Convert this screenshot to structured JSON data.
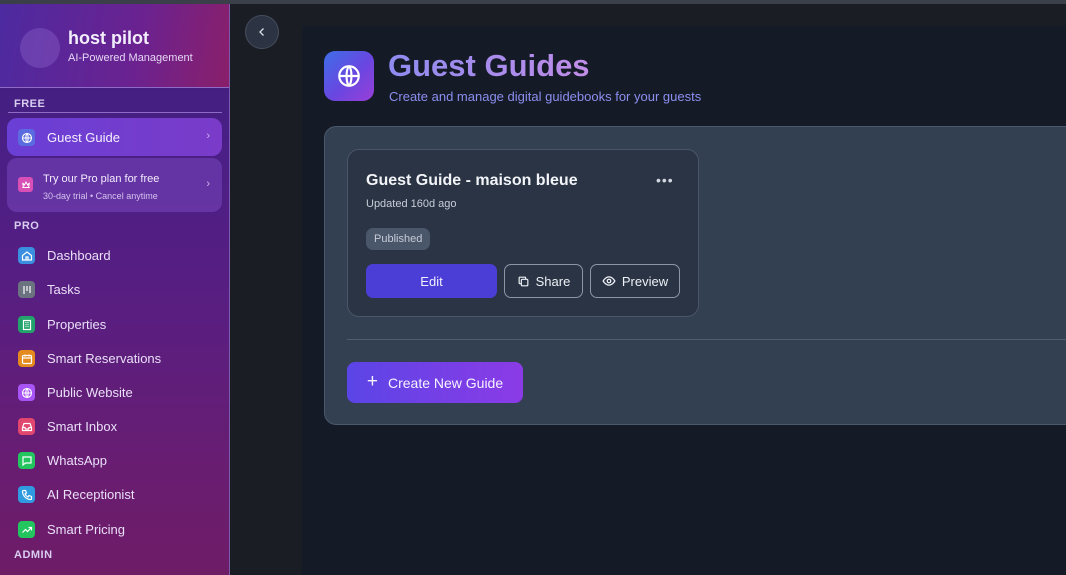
{
  "brand": {
    "name": "host pilot",
    "tagline": "AI-Powered Management"
  },
  "sidebar": {
    "free_label": "FREE",
    "guest_guide": {
      "label": "Guest Guide",
      "icon": "globe-icon"
    },
    "promo": {
      "title": "Try our Pro plan for free",
      "subtitle": "30-day trial • Cancel anytime",
      "icon": "crown-icon"
    },
    "pro_label": "PRO",
    "items": [
      {
        "label": "Dashboard",
        "icon": "home-icon",
        "color": "#3b8fe0"
      },
      {
        "label": "Tasks",
        "icon": "tasks-icon",
        "color": "#6b7280"
      },
      {
        "label": "Properties",
        "icon": "building-icon",
        "color": "#22a36b"
      },
      {
        "label": "Smart Reservations",
        "icon": "calendar-icon",
        "color": "#e58a1e"
      },
      {
        "label": "Public Website",
        "icon": "globe-icon",
        "color": "#a855f7"
      },
      {
        "label": "Smart Inbox",
        "icon": "inbox-icon",
        "color": "#e0466e"
      },
      {
        "label": "WhatsApp",
        "icon": "chat-icon",
        "color": "#22c55e"
      },
      {
        "label": "AI Receptionist",
        "icon": "phone-icon",
        "color": "#2f9ae0"
      },
      {
        "label": "Smart Pricing",
        "icon": "trending-up-icon",
        "color": "#22c55e"
      }
    ],
    "admin_label": "ADMIN"
  },
  "header": {
    "title": "Guest Guides",
    "subtitle": "Create and manage digital guidebooks for your guests",
    "icon": "globe-icon"
  },
  "guides": [
    {
      "title": "Guest Guide - maison bleue",
      "updated": "Updated 160d ago",
      "status": "Published",
      "edit_label": "Edit",
      "share_label": "Share",
      "preview_label": "Preview",
      "more": "•••"
    }
  ],
  "create_label": "Create New Guide",
  "create_icon": "+",
  "colors": {
    "accent": "#4a3ed6",
    "sidebar": "#4a1f86"
  }
}
